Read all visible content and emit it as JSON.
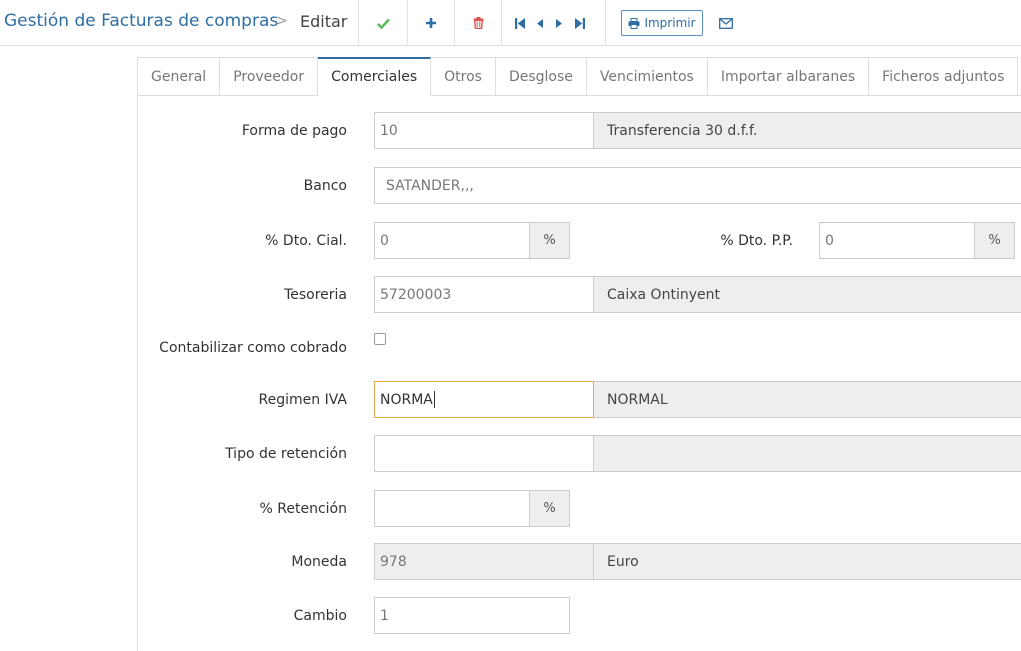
{
  "header": {
    "title": "Gestión de Facturas de compras",
    "separator": ">",
    "current": "Editar",
    "print_label": "Imprimir",
    "icons": [
      "check-icon",
      "plus-icon",
      "trash-icon",
      "first-icon",
      "prev-icon",
      "next-icon",
      "last-icon",
      "print-icon",
      "envelope-icon"
    ],
    "colors": {
      "accent": "#2f6ea5",
      "save": "#5cb85c",
      "delete": "#d9534f",
      "focus": "#e7a84a"
    }
  },
  "tabs": [
    {
      "label": "General"
    },
    {
      "label": "Proveedor"
    },
    {
      "label": "Comerciales"
    },
    {
      "label": "Otros"
    },
    {
      "label": "Desglose"
    },
    {
      "label": "Vencimientos"
    },
    {
      "label": "Importar albaranes"
    },
    {
      "label": "Ficheros adjuntos"
    }
  ],
  "active_tab": "Comerciales",
  "form": {
    "forma_pago": {
      "label": "Forma de pago",
      "value": "10",
      "desc": "Transferencia 30 d.f.f."
    },
    "banco": {
      "label": "Banco",
      "value": "SATANDER,,,"
    },
    "dto_cial": {
      "label": "% Dto. Cial.",
      "value": "0",
      "addon": "%"
    },
    "dto_pp": {
      "label": "% Dto. P.P.",
      "value": "0",
      "addon": "%"
    },
    "tesoreria": {
      "label": "Tesoreria",
      "value": "57200003",
      "desc": "Caixa Ontinyent"
    },
    "contabilizar": {
      "label": "Contabilizar como cobrado",
      "checked": false
    },
    "regimen_iva": {
      "label": "Regimen IVA",
      "value": "NORMA",
      "desc": "NORMAL"
    },
    "tipo_retencion": {
      "label": "Tipo de retención",
      "value": "",
      "desc": ""
    },
    "retencion": {
      "label": "% Retención",
      "value": "",
      "addon": "%"
    },
    "moneda": {
      "label": "Moneda",
      "value": "978",
      "desc": "Euro"
    },
    "cambio": {
      "label": "Cambio",
      "value": "1"
    }
  }
}
